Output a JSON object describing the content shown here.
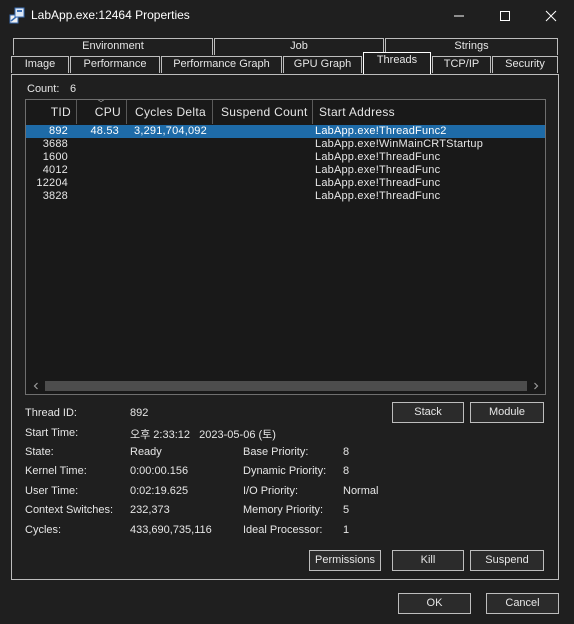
{
  "window": {
    "title": "LabApp.exe:12464 Properties",
    "minimize_glyph": "—",
    "maximize_glyph": "☐",
    "close_glyph": "✕",
    "app_icon": "process-icon"
  },
  "tabs": {
    "row1": [
      "Environment",
      "Job",
      "Strings"
    ],
    "row2": [
      "Image",
      "Performance",
      "Performance Graph",
      "GPU Graph",
      "Threads",
      "TCP/IP",
      "Security"
    ],
    "active": "Threads"
  },
  "count": {
    "label": "Count:",
    "value": "6"
  },
  "threads": {
    "columns": [
      "TID",
      "CPU",
      "Cycles Delta",
      "Suspend Count",
      "Start Address"
    ],
    "sort_column": "CPU",
    "rows": [
      {
        "tid": "892",
        "cpu": "48.53",
        "cycles_delta": "3,291,704,092",
        "suspend_count": "",
        "start_address": "LabApp.exe!ThreadFunc2",
        "selected": true
      },
      {
        "tid": "3688",
        "cpu": "",
        "cycles_delta": "",
        "suspend_count": "",
        "start_address": "LabApp.exe!WinMainCRTStartup",
        "selected": false
      },
      {
        "tid": "1600",
        "cpu": "",
        "cycles_delta": "",
        "suspend_count": "",
        "start_address": "LabApp.exe!ThreadFunc",
        "selected": false
      },
      {
        "tid": "4012",
        "cpu": "",
        "cycles_delta": "",
        "suspend_count": "",
        "start_address": "LabApp.exe!ThreadFunc",
        "selected": false
      },
      {
        "tid": "12204",
        "cpu": "",
        "cycles_delta": "",
        "suspend_count": "",
        "start_address": "LabApp.exe!ThreadFunc",
        "selected": false
      },
      {
        "tid": "3828",
        "cpu": "",
        "cycles_delta": "",
        "suspend_count": "",
        "start_address": "LabApp.exe!ThreadFunc",
        "selected": false
      }
    ]
  },
  "details": {
    "thread_id": {
      "label": "Thread ID:",
      "value": "892"
    },
    "start_time": {
      "label": "Start Time:",
      "value": "오후 2:33:12   2023-05-06 (토)"
    },
    "state": {
      "label": "State:",
      "value": "Ready"
    },
    "kernel_time": {
      "label": "Kernel Time:",
      "value": "0:00:00.156"
    },
    "user_time": {
      "label": "User Time:",
      "value": "0:02:19.625"
    },
    "context_switches": {
      "label": "Context Switches:",
      "value": "232,373"
    },
    "cycles": {
      "label": "Cycles:",
      "value": "433,690,735,116"
    },
    "base_priority": {
      "label": "Base Priority:",
      "value": "8"
    },
    "dynamic_priority": {
      "label": "Dynamic Priority:",
      "value": "8"
    },
    "io_priority": {
      "label": "I/O Priority:",
      "value": "Normal"
    },
    "memory_priority": {
      "label": "Memory Priority:",
      "value": "5"
    },
    "ideal_processor": {
      "label": "Ideal Processor:",
      "value": "1"
    }
  },
  "buttons": {
    "stack": "Stack",
    "module": "Module",
    "permissions": "Permissions",
    "kill": "Kill",
    "suspend": "Suspend",
    "ok": "OK",
    "cancel": "Cancel"
  },
  "colors": {
    "background": "#1f1f1f",
    "list_background": "#191919",
    "selection": "#1e6ba8",
    "border": "#bdbdbd"
  }
}
